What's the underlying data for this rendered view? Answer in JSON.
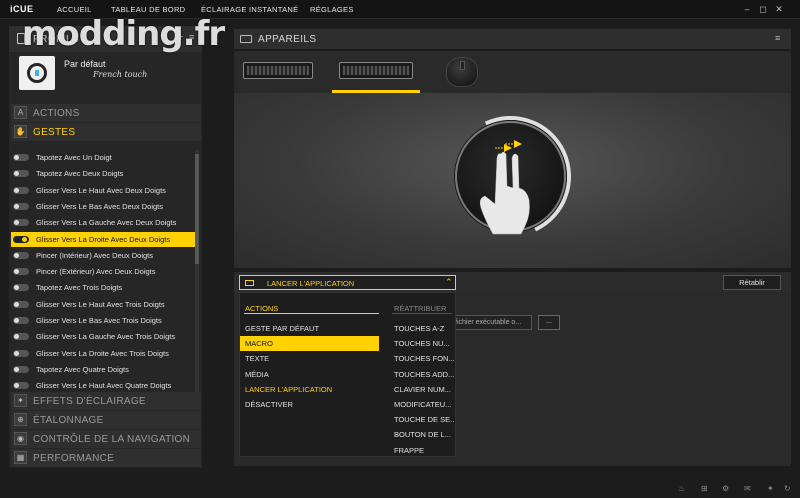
{
  "app": {
    "logo": "iCUE"
  },
  "nav": [
    "ACCUEIL",
    "TABLEAU DE BORD",
    "ÉCLAIRAGE INSTANTANÉ",
    "RÉGLAGES"
  ],
  "window_controls": {
    "minimize": "–",
    "restore": "◻",
    "close": "✕",
    "extra": "▭"
  },
  "watermark": "modding.fr",
  "profiles": {
    "title": "PROFILS",
    "add": "+",
    "menu": "≡",
    "current_name": "Par défaut",
    "current_tag": "French touch"
  },
  "sections": {
    "actions": {
      "label": "ACTIONS",
      "icon": "A"
    },
    "gestes": {
      "label": "GESTES",
      "icon": "✋"
    },
    "effets": {
      "label": "EFFETS D'ÉCLAIRAGE",
      "icon": "✦"
    },
    "etalonnage": {
      "label": "ÉTALONNAGE",
      "icon": "⊕"
    },
    "navigation": {
      "label": "CONTRÔLE DE LA NAVIGATION",
      "icon": "◉"
    },
    "performance": {
      "label": "PERFORMANCE",
      "icon": "▦"
    }
  },
  "gestures": [
    "Tapotez Avec Un Doigt",
    "Tapotez Avec Deux Doigts",
    "Glisser Vers Le Haut Avec Deux Doigts",
    "Glisser Vers Le Bas Avec Deux Doigts",
    "Glisser Vers La Gauche Avec Deux Doigts",
    "Glisser Vers La Droite Avec Deux Doigts",
    "Pincer (Intérieur) Avec Deux Doigts",
    "Pincer (Extérieur) Avec Deux Doigts",
    "Tapotez Avec Trois Doigts",
    "Glisser Vers Le Haut Avec Trois Doigts",
    "Glisser Vers Le Bas Avec Trois Doigts",
    "Glisser Vers La Gauche Avec Trois Doigts",
    "Glisser Vers La Droite Avec Trois Doigts",
    "Tapotez Avec Quatre Doigts",
    "Glisser Vers Le Haut Avec Quatre Doigts"
  ],
  "selected_gesture_index": 5,
  "devices": {
    "title": "APPAREILS",
    "menu": "≡"
  },
  "action_dropdown": {
    "value": "LANCER L'APPLICATION",
    "chevron": "⌃"
  },
  "reset_label": "Rétablir",
  "file_field": {
    "placeholder": "fichier exécutable o..."
  },
  "browse_label": "...",
  "dropdown": {
    "col1_title": "ACTIONS",
    "col2_title": "RÉATTRIBUER",
    "col1_items": [
      "GESTE PAR DÉFAUT",
      "MACRO",
      "TEXTE",
      "MÉDIA",
      "LANCER L'APPLICATION",
      "DÉSACTIVER"
    ],
    "col2_items": [
      "TOUCHES A-Z",
      "TOUCHES NU...",
      "TOUCHES FON...",
      "TOUCHES ADD...",
      "CLAVIER NUM...",
      "MODIFICATEU...",
      "TOUCHE DE SE...",
      "BOUTON DE L...",
      "FRAPPE"
    ]
  },
  "colors": {
    "accent": "#ffd200",
    "bg": "#1c1c1c",
    "panel": "#262626"
  },
  "footer_icons": [
    "♨",
    "⊞",
    "⚙",
    "✉",
    "✦",
    "↻"
  ]
}
